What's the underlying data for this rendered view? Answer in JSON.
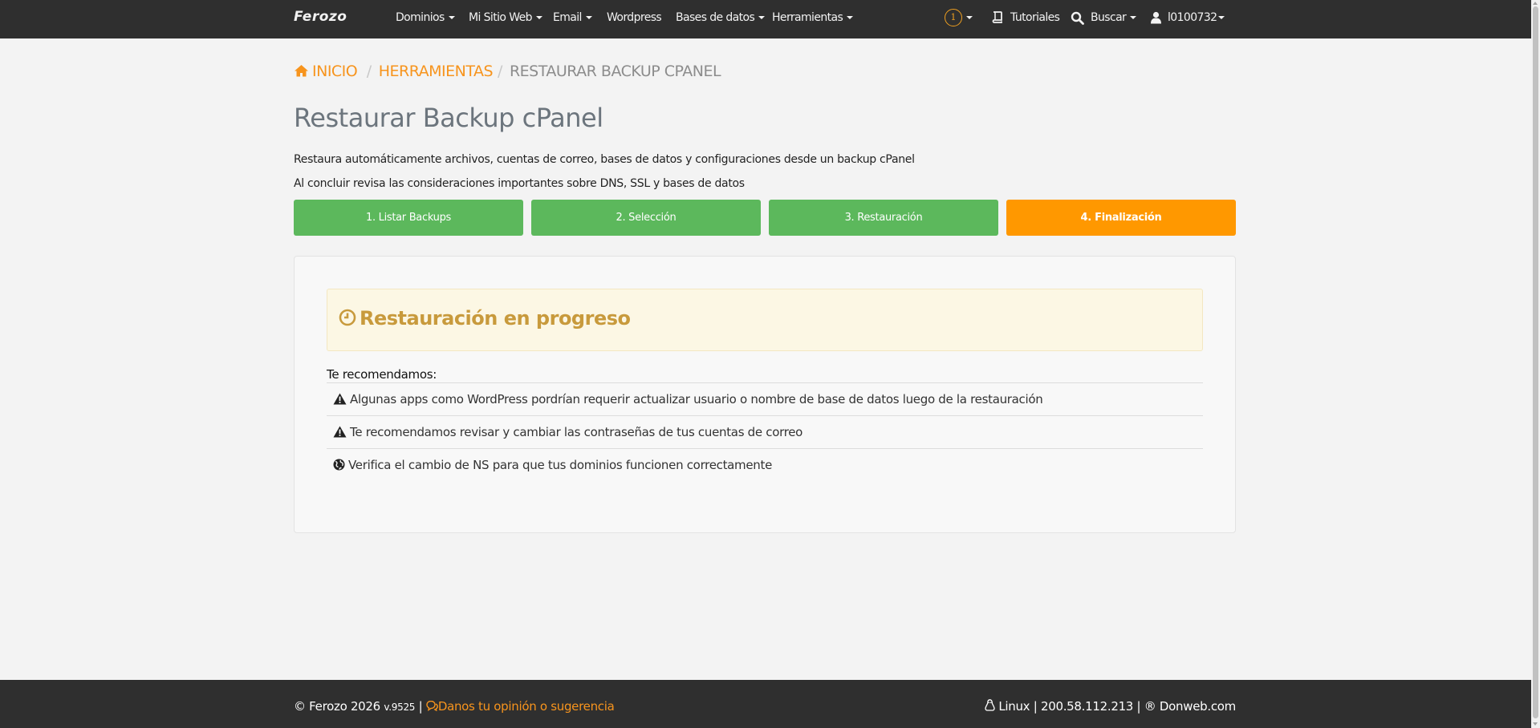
{
  "navbar": {
    "brand": "Ferozo",
    "menu": [
      {
        "label": "Dominios"
      },
      {
        "label": "Mi Sitio Web"
      },
      {
        "label": "Email"
      },
      {
        "label": "Wordpress"
      },
      {
        "label": "Bases de datos"
      },
      {
        "label": "Herramientas"
      }
    ],
    "notifications_count": "1",
    "tutorials_label": "Tutoriales",
    "search_label": "Buscar",
    "user_label": "l0100732"
  },
  "breadcrumb": {
    "home": "INICIO",
    "tools": "HERRAMIENTAS",
    "current": "RESTAURAR BACKUP CPANEL"
  },
  "page": {
    "title": "Restaurar Backup cPanel",
    "description_1": "Restaura automáticamente archivos, cuentas de correo, bases de datos y configuraciones desde un backup cPanel",
    "description_2": "Al concluir revisa las consideraciones importantes sobre DNS, SSL y bases de datos"
  },
  "steps": [
    {
      "label": "1. Listar Backups",
      "state": "done"
    },
    {
      "label": "2. Selección",
      "state": "done"
    },
    {
      "label": "3. Restauración",
      "state": "done"
    },
    {
      "label": "4. Finalización",
      "state": "active"
    }
  ],
  "status": {
    "title": "Restauración en progreso"
  },
  "recommendations": {
    "title": "Te recomendamos:",
    "items": [
      {
        "icon": "warning-icon",
        "text": "Algunas apps como WordPress pordrían requerir actualizar usuario o nombre de base de datos luego de la restauración"
      },
      {
        "icon": "warning-icon",
        "text": "Te recomendamos revisar y cambiar las contraseñas de tus cuentas de correo"
      },
      {
        "icon": "globe-icon",
        "text": "Verifica el cambio de NS para que tus dominios funcionen correctamente"
      }
    ]
  },
  "footer": {
    "copyright": "© Ferozo 2026",
    "version": "v.9525",
    "separator": "|",
    "feedback_link": "Danos tu opinión o sugerencia",
    "os": "Linux",
    "ip": "200.58.112.213",
    "provider": "® Donweb.com"
  },
  "colors": {
    "accent": "#f7941d",
    "step_done": "#5cb85c",
    "step_active": "#ff9800",
    "navbar": "#2f2f2f"
  }
}
